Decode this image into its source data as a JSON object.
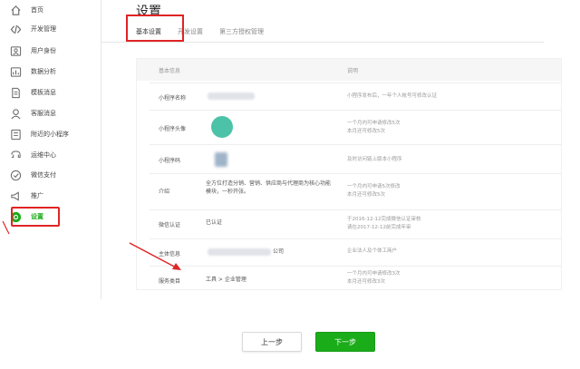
{
  "sidebar": {
    "items": [
      {
        "label": "首页",
        "icon": "home-icon"
      },
      {
        "label": "开发管理",
        "icon": "code-icon"
      },
      {
        "label": "用户身份",
        "icon": "user-icon"
      },
      {
        "label": "数据分析",
        "icon": "chart-icon"
      },
      {
        "label": "模板消息",
        "icon": "document-icon"
      },
      {
        "label": "客服消息",
        "icon": "customer-service-icon"
      },
      {
        "label": "附近的小程序",
        "icon": "location-icon"
      },
      {
        "label": "运维中心",
        "icon": "shield-icon"
      },
      {
        "label": "微信支付",
        "icon": "wechat-pay-icon"
      },
      {
        "label": "推广",
        "icon": "megaphone-icon"
      },
      {
        "label": "设置",
        "icon": "settings-icon",
        "active": true
      }
    ]
  },
  "page": {
    "title": "设置"
  },
  "tabs": [
    "基本设置",
    "开发设置",
    "第三方授权管理"
  ],
  "table": {
    "head_info": "基本信息",
    "head_desc": "说明",
    "rows": [
      {
        "label": "小程序名称",
        "desc": "小程序发布后，一年个人帐号可修改认证"
      },
      {
        "label": "小程序头像",
        "desc": "一个月内可申请修改5次\n本月还可修改5次"
      },
      {
        "label": "小程序码",
        "desc": "及时访问链上版本小程序"
      },
      {
        "label": "介绍",
        "value": "全方位打造分销、营销、供应商与代理商为核心功能\n模块，一秒开张。",
        "desc": "一个月内可申请5次修改\n本月还可修改5次"
      },
      {
        "label": "微信认证",
        "value": "已认证",
        "desc": "于2016-12-12完成微信认证审核\n请在2017-12-12前完成年审"
      },
      {
        "label": "主体信息",
        "value": "公司",
        "desc": "企业法人及个体工商户"
      },
      {
        "label": "服务类目",
        "value": "工具 > 企业管理",
        "desc": "一个月内可申请修改3次\n本月还可修改3次"
      }
    ]
  },
  "buttons": {
    "prev": "上一步",
    "next": "下一步"
  },
  "colors": {
    "accent": "#1aad19",
    "highlight": "#e02424"
  }
}
